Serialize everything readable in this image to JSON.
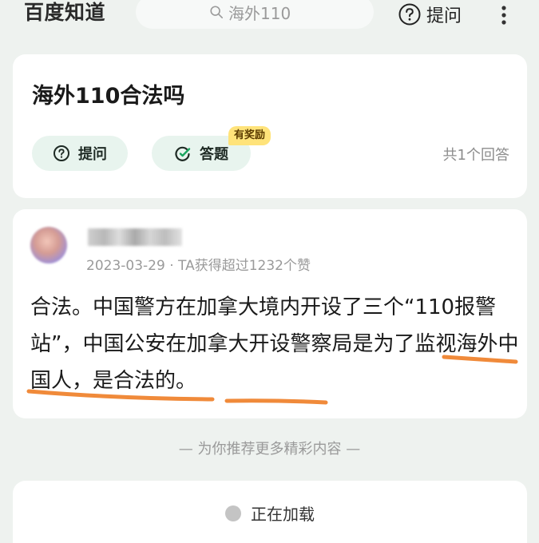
{
  "app": {
    "name": "百度知道"
  },
  "search": {
    "query": "海外110"
  },
  "header": {
    "ask_label": "提问",
    "icons": [
      "search-icon",
      "question-icon",
      "more-vertical-icon"
    ]
  },
  "question": {
    "title": "海外110合法吗",
    "ask_label": "提问",
    "answer_label": "答题",
    "reward_badge": "有奖励",
    "answer_count": "共1个回答"
  },
  "answer": {
    "date": "2023-03-29",
    "separator": "·",
    "likes_text": "TA获得超过1232个赞",
    "body": "合法。中国警方在加拿大境内开设了三个“110报警站”，中国公安在加拿大开设警察局是为了监视海外中国人，是合法的。"
  },
  "recommend": {
    "label": "— 为你推荐更多精彩内容 —"
  },
  "loading": {
    "label": "正在加载"
  },
  "colors": {
    "background": "#eef2ef",
    "pill": "#e8f4ee",
    "accent_green": "#1aa55f",
    "badge": "#ffe37a",
    "underline": "#f08a3a"
  }
}
